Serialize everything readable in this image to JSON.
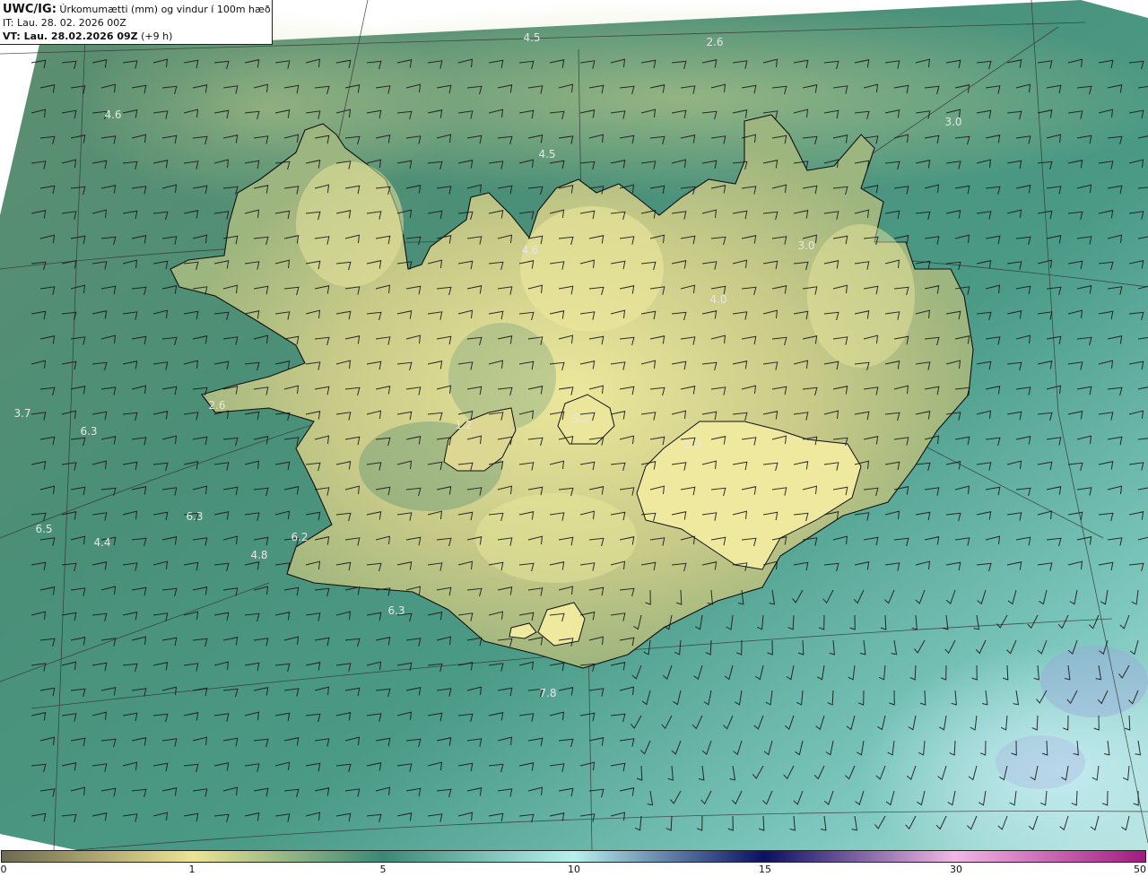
{
  "header": {
    "product_code": "UWC/IG:",
    "product_desc": "Úrkomumætti (mm) og vindur í 100m hæð",
    "init_line": "IT: Lau. 28. 02. 2026 00Z",
    "valid_prefix": "VT: Lau. 28.02.2026 09Z",
    "valid_suffix": "(+9 h)"
  },
  "colors": {
    "sea_dark": "#3a8a7a",
    "land_bright": "#e6e39a",
    "land_mid": "#a9bb7f",
    "coast_line": "#111111",
    "grid_line": "#333333",
    "value_label": "#e6e6e6"
  },
  "colorbar": {
    "ticks": [
      "0",
      "1",
      "5",
      "10",
      "15",
      "30",
      "50"
    ],
    "stops": [
      {
        "value": "0",
        "color": "#6e6a52"
      },
      {
        "value": "1",
        "color": "#eee392"
      },
      {
        "value": "5",
        "color": "#3b8877"
      },
      {
        "value": "10",
        "color": "#b8f0ee"
      },
      {
        "value": "15",
        "color": "#0b1060"
      },
      {
        "value": "30",
        "color": "#f2b6e6"
      },
      {
        "value": "50",
        "color": "#a11a80"
      }
    ]
  },
  "map_labels": [
    {
      "text": "4.5"
    },
    {
      "text": "2.6"
    },
    {
      "text": "4.6"
    },
    {
      "text": "3.0"
    },
    {
      "text": "4.5"
    },
    {
      "text": "4.6"
    },
    {
      "text": "3.0"
    },
    {
      "text": "4.0"
    },
    {
      "text": "3.7"
    },
    {
      "text": "2.6"
    },
    {
      "text": "6.3"
    },
    {
      "text": "1.2"
    },
    {
      "text": "5.2"
    },
    {
      "text": "1.0"
    },
    {
      "text": "6.5"
    },
    {
      "text": "4.4"
    },
    {
      "text": "6.3"
    },
    {
      "text": "6.2"
    },
    {
      "text": "4.8"
    },
    {
      "text": "6.3"
    },
    {
      "text": "7.8"
    }
  ]
}
